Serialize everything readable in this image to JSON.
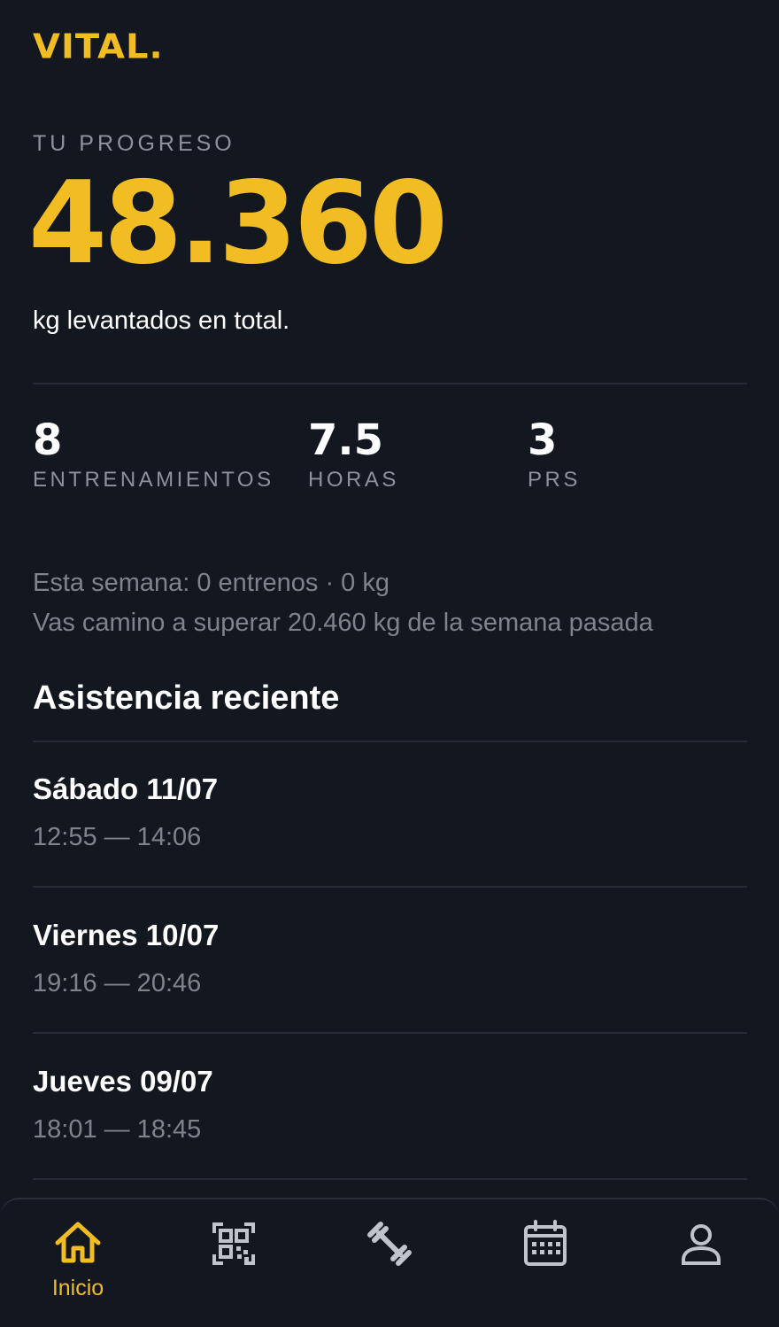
{
  "app": {
    "brand": "VITAL."
  },
  "progress": {
    "eyebrow": "TU PROGRESO",
    "value": "48.360",
    "caption": "kg levantados en total."
  },
  "stats": [
    {
      "value": "8",
      "label": "ENTRENAMIENTOS"
    },
    {
      "value": "7.5",
      "label": "HORAS"
    },
    {
      "value": "3",
      "label": "PRS"
    }
  ],
  "week": {
    "summary": "Esta semana: 0 entrenos · 0 kg",
    "comparison": "Vas camino a superar 20.460 kg de la semana pasada"
  },
  "attendance": {
    "title": "Asistencia reciente",
    "items": [
      {
        "day": "Sábado 11/07",
        "time": "12:55 — 14:06"
      },
      {
        "day": "Viernes 10/07",
        "time": "19:16 — 20:46"
      },
      {
        "day": "Jueves 09/07",
        "time": "18:01 — 18:45"
      }
    ]
  },
  "tabbar": {
    "active": "home",
    "items": [
      {
        "icon": "home-icon",
        "label": "Inicio"
      },
      {
        "icon": "qr-code-icon"
      },
      {
        "icon": "dumbbell-icon"
      },
      {
        "icon": "calendar-icon"
      },
      {
        "icon": "user-icon"
      }
    ]
  },
  "colors": {
    "background": "#131720",
    "accent": "#f2bd22",
    "muted_text": "#8d929c",
    "icon_inactive": "#bfc3ca",
    "divider": "#262b35"
  }
}
